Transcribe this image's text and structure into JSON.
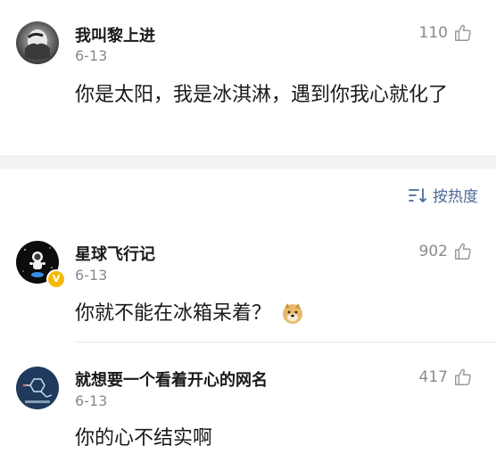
{
  "comments": [
    {
      "username": "我叫黎上进",
      "date": "6-13",
      "likes": "110",
      "content": "你是太阳，我是冰淇淋，遇到你我心就化了",
      "avatar_icon": "person-covering-face-avatar"
    },
    {
      "username": "星球飞行记",
      "date": "6-13",
      "likes": "902",
      "content": "你就不能在冰箱呆着？",
      "avatar_icon": "astronaut-avatar",
      "emoji": "doge-emoji"
    },
    {
      "username": "就想要一个看着开心的网名",
      "date": "6-13",
      "likes": "417",
      "content": "你的心不结实啊",
      "avatar_icon": "molecule-avatar"
    }
  ],
  "sort": {
    "label": "按热度",
    "icon": "sort-icon"
  },
  "colors": {
    "accent": "#4a6a96",
    "muted": "#8a8a8a",
    "band": "#f2f2f2",
    "vip": "#f5b800"
  }
}
